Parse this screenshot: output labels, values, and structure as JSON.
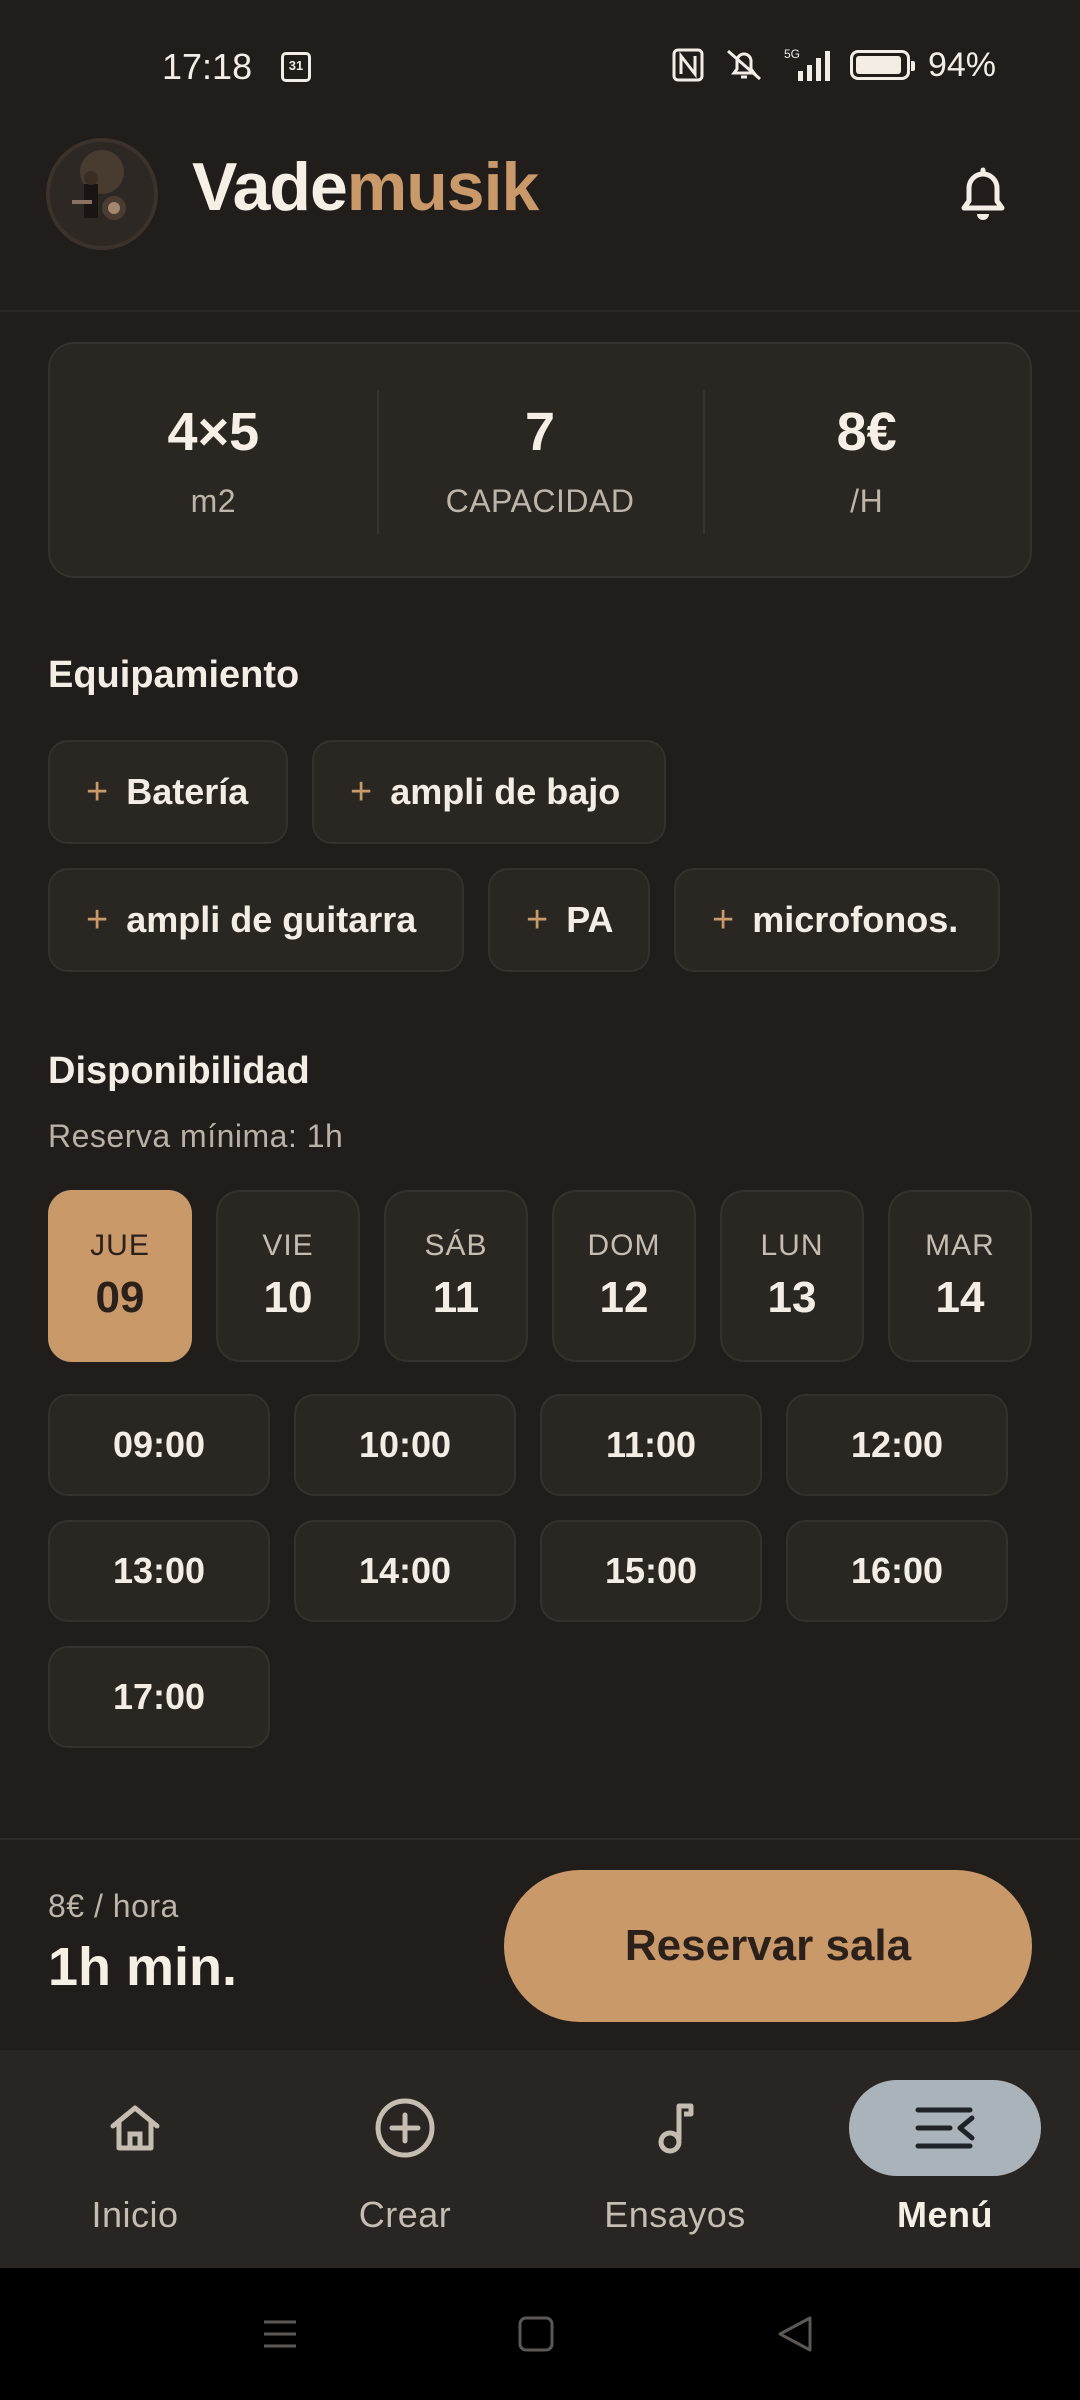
{
  "status_bar": {
    "time": "17:18",
    "calendar_badge": "31",
    "network": "5G",
    "battery_percent": "94%",
    "battery_level": 0.94
  },
  "header": {
    "title_part1": "Vade",
    "title_part2": "musik",
    "accent_color": "#c9996a"
  },
  "stats": [
    {
      "value": "4×5",
      "label": "m2"
    },
    {
      "value": "7",
      "label": "CAPACIDAD"
    },
    {
      "value": "8€",
      "label": "/H"
    }
  ],
  "equipment": {
    "title": "Equipamiento",
    "items": [
      "Batería",
      "ampli de bajo",
      "ampli de guitarra",
      "PA",
      "microfonos."
    ]
  },
  "availability": {
    "title": "Disponibilidad",
    "subtitle": "Reserva mínima: 1h",
    "days": [
      {
        "name": "JUE",
        "num": "09",
        "selected": true
      },
      {
        "name": "VIE",
        "num": "10",
        "selected": false
      },
      {
        "name": "SÁB",
        "num": "11",
        "selected": false
      },
      {
        "name": "DOM",
        "num": "12",
        "selected": false
      },
      {
        "name": "LUN",
        "num": "13",
        "selected": false
      },
      {
        "name": "MAR",
        "num": "14",
        "selected": false
      }
    ],
    "slots": [
      "09:00",
      "10:00",
      "11:00",
      "12:00",
      "13:00",
      "14:00",
      "15:00",
      "16:00",
      "17:00"
    ]
  },
  "booking": {
    "price_per_hour": "8€ / hora",
    "minimum": "1h min.",
    "button": "Reservar sala"
  },
  "nav": {
    "items": [
      {
        "label": "Inicio",
        "icon": "home-icon",
        "active": false
      },
      {
        "label": "Crear",
        "icon": "add-circle-icon",
        "active": false
      },
      {
        "label": "Ensayos",
        "icon": "music-note-icon",
        "active": false
      },
      {
        "label": "Menú",
        "icon": "menu-icon",
        "active": true
      }
    ]
  }
}
